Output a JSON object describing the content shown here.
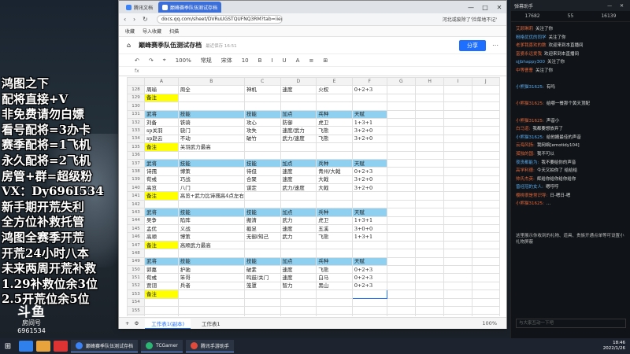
{
  "overlay": {
    "lines": [
      "鸿图之下",
      "配将直接+V",
      "非免费请勿白嫖",
      "看号配将=3办卡",
      "赛季配将=1飞机",
      "永久配将=2飞机",
      "房管+群=超级粉",
      "VX：Dy696I534",
      "新手期开荒失利",
      "全方位补救托管",
      "鸿图全赛季开荒",
      "开荒24小时八本",
      "未来两周开荒补救",
      "1.29补救位余3位",
      "2.5开荒位余5位"
    ]
  },
  "logo": {
    "name": "斗鱼",
    "sub": "房间号",
    "room": "6961534"
  },
  "browser": {
    "tabs": [
      "腾讯文档",
      "巅峰赛季队伍测试存档"
    ],
    "url": "docs.qq.com/sheet/DVRuUGSTQUFNQ3RM?tab=iiepqi",
    "news": "河北或废除了'捡菜地不记'",
    "bookmarks": [
      "收藏",
      "导入收藏",
      "扫描"
    ],
    "controls": [
      "—",
      "□",
      "✕"
    ]
  },
  "doc": {
    "title": "巅峰赛季队伍测试存档",
    "saved": "最近保存 16:51",
    "share": "分享",
    "toolbar": [
      "↶",
      "↷",
      "⌖",
      "100%",
      "常规",
      "宋体",
      "10",
      "B",
      "I",
      "U",
      "A",
      "≡",
      "⊞"
    ],
    "col_letters": [
      "",
      "A",
      "B",
      "C",
      "D",
      "E",
      "F",
      "G",
      "H",
      "I",
      "J"
    ],
    "rows": [
      {
        "n": "128",
        "cells": [
          "周瑜",
          "周全",
          "神机",
          "速度",
          "火权",
          "0+2+3",
          "",
          "",
          "",
          ""
        ]
      },
      {
        "n": "129",
        "cells": [
          "备注",
          "",
          "",
          "",
          "",
          "",
          "",
          "",
          "",
          ""
        ],
        "note": true
      },
      {
        "n": "130",
        "cells": [
          "",
          "",
          "",
          "",
          "",
          "",
          "",
          "",
          "",
          ""
        ]
      },
      {
        "n": "131",
        "cells": [
          "武将",
          "技能",
          "技能",
          "加点",
          "兵种",
          "天赋",
          "",
          "",
          "",
          ""
        ],
        "hdr": true
      },
      {
        "n": "132",
        "cells": [
          "刘备",
          "铁骑",
          "攻心",
          "防御",
          "虎卫",
          "1+3+1",
          "",
          "",
          "",
          ""
        ]
      },
      {
        "n": "133",
        "cells": [
          "sp关羽",
          "骁门",
          "攻失",
          "速度/武力",
          "飞熊",
          "3+2+0",
          "",
          "",
          "",
          ""
        ]
      },
      {
        "n": "134",
        "cells": [
          "sp赵云",
          "不动",
          "破竹",
          "武力/速度",
          "飞熊",
          "3+2+0",
          "",
          "",
          "",
          ""
        ]
      },
      {
        "n": "135",
        "cells": [
          "备注",
          "关羽武力最高",
          "",
          "",
          "",
          "",
          "",
          "",
          "",
          ""
        ],
        "note": true
      },
      {
        "n": "136",
        "cells": [
          "",
          "",
          "",
          "",
          "",
          "",
          "",
          "",
          "",
          ""
        ]
      },
      {
        "n": "137",
        "cells": [
          "武将",
          "技能",
          "技能",
          "加点",
          "兵种",
          "天赋",
          "",
          "",
          "",
          ""
        ],
        "hdr": true
      },
      {
        "n": "138",
        "cells": [
          "诗孺",
          "博策",
          "待但",
          "速度",
          "青州/大戟",
          "0+2+3",
          "",
          "",
          "",
          ""
        ]
      },
      {
        "n": "139",
        "cells": [
          "荀彧",
          "巧战",
          "合聚",
          "速度",
          "大戟",
          "3+2+0",
          "",
          "",
          "",
          ""
        ]
      },
      {
        "n": "140",
        "cells": [
          "高览",
          "八门",
          "谋定",
          "武力/速度",
          "大戟",
          "3+2+0",
          "",
          "",
          "",
          ""
        ]
      },
      {
        "n": "141",
        "cells": [
          "备注",
          "高览+武力比诗孺高4点左右",
          "",
          "",
          "",
          "",
          "",
          "",
          "",
          ""
        ],
        "note": true
      },
      {
        "n": "142",
        "cells": [
          "",
          "",
          "",
          "",
          "",
          "",
          "",
          "",
          "",
          ""
        ]
      },
      {
        "n": "143",
        "cells": [
          "武将",
          "技能",
          "技能",
          "加点",
          "兵种",
          "天赋",
          "",
          "",
          "",
          ""
        ],
        "hdr": true
      },
      {
        "n": "144",
        "cells": [
          "吴争",
          "陷阵",
          "搬清",
          "武力",
          "虎卫",
          "1+3+1",
          "",
          "",
          "",
          ""
        ]
      },
      {
        "n": "145",
        "cells": [
          "孟优",
          "义战",
          "截足",
          "速度",
          "五溪",
          "3+0+0",
          "",
          "",
          "",
          ""
        ]
      },
      {
        "n": "146",
        "cells": [
          "高顺",
          "博策",
          "无御/知己",
          "武力",
          "飞熊",
          "1+3+1",
          "",
          "",
          "",
          ""
        ]
      },
      {
        "n": "147",
        "cells": [
          "备注",
          "高顺武力最高",
          "",
          "",
          "",
          "",
          "",
          "",
          "",
          ""
        ],
        "note": true
      },
      {
        "n": "148",
        "cells": [
          "",
          "",
          "",
          "",
          "",
          "",
          "",
          "",
          "",
          ""
        ]
      },
      {
        "n": "149",
        "cells": [
          "武将",
          "技能",
          "技能",
          "加点",
          "兵种",
          "天赋",
          "",
          "",
          "",
          ""
        ],
        "hdr": true
      },
      {
        "n": "150",
        "cells": [
          "郭嘉",
          "护驰",
          "破素",
          "速度",
          "飞熊",
          "0+2+3",
          "",
          "",
          "",
          ""
        ]
      },
      {
        "n": "151",
        "cells": [
          "荀彧",
          "笨哥",
          "鸣鼓/关门",
          "速度",
          "白马",
          "0+2+3",
          "",
          "",
          "",
          ""
        ]
      },
      {
        "n": "152",
        "cells": [
          "贾诩",
          "兵者",
          "笼罩",
          "智力",
          "黑山",
          "0+2+3",
          "",
          "",
          "",
          ""
        ]
      },
      {
        "n": "153",
        "cells": [
          "备注",
          "",
          "",
          "",
          "",
          "",
          "",
          "",
          "",
          ""
        ],
        "note": true
      },
      {
        "n": "154",
        "cells": [
          "",
          "",
          "",
          "",
          "",
          "",
          "",
          "",
          "",
          ""
        ]
      },
      {
        "n": "155",
        "cells": [
          "",
          "",
          "",
          "",
          "",
          "",
          "",
          "",
          "",
          ""
        ]
      },
      {
        "n": "156",
        "cells": [
          "",
          "",
          "",
          "",
          "",
          "",
          "",
          "",
          "",
          ""
        ]
      }
    ],
    "sheet_tabs": [
      "工作表1(副本)",
      "工作表1"
    ],
    "zoom": "100%"
  },
  "chat": {
    "header": "弹幕助手",
    "stats": [
      "17682",
      "55",
      "16139"
    ],
    "messages": [
      {
        "u": "艾颜琳莉",
        "t": "关注了你"
      },
      {
        "u": "粉格优优的同学",
        "t": "关注了你"
      },
      {
        "u": "老爹我喜欢的数",
        "t": "欢迎来到本直播间"
      },
      {
        "u": "富婆永远爱我",
        "t": "欢迎来到本直播间"
      },
      {
        "u": "sjjbhappy300",
        "t": "关注了你"
      },
      {
        "u": "中等曹曹",
        "t": "关注了你"
      },
      {
        "u": "",
        "t": ""
      },
      {
        "u": "小熊猫31625:",
        "t": "有吗"
      },
      {
        "u": "",
        "t": ""
      },
      {
        "u": "小熊猫31625:",
        "t": "给哪一餐那个黄天顶配"
      },
      {
        "u": "",
        "t": ""
      },
      {
        "u": "小熊猫31625:",
        "t": "声音小"
      },
      {
        "u": "白马道:",
        "t": "我都要想放弃了"
      },
      {
        "u": "小熊猫31625:",
        "t": "给他搬最佳的声音"
      },
      {
        "u": "云海风扬:",
        "t": "我网络[emotidy104]"
      },
      {
        "u": "孤独的国:",
        "t": "我不可以"
      },
      {
        "u": "夜丧都能为:",
        "t": "我不要给你的声音"
      },
      {
        "u": "高学利德:",
        "t": "今天又拍你了 给给给"
      },
      {
        "u": "帅氏杰英:",
        "t": "辉给你给你给你给你"
      },
      {
        "u": "曾经冠的女人:",
        "t": "嗯哼哼"
      },
      {
        "u": "樱桃很是常识导:",
        "t": "日-嗯日-嗯"
      },
      {
        "u": "小熊猫31625:",
        "t": "..."
      }
    ],
    "gift_note": "这里展示你收到的礼物、道具、贵族开通点单等可设置小礼物屏蔽",
    "input_placeholder": "与大家互动一下吧"
  },
  "taskbar": {
    "tasks": [
      "巅峰赛季队伍测试存档",
      "TCGamer",
      "腾讯手游助手"
    ],
    "time": "18:46",
    "date": "2022/1/26"
  },
  "colors": {
    "header_fill": "#8fd0f0",
    "note_fill": "#ffff00",
    "accent": "#1e6fff"
  }
}
